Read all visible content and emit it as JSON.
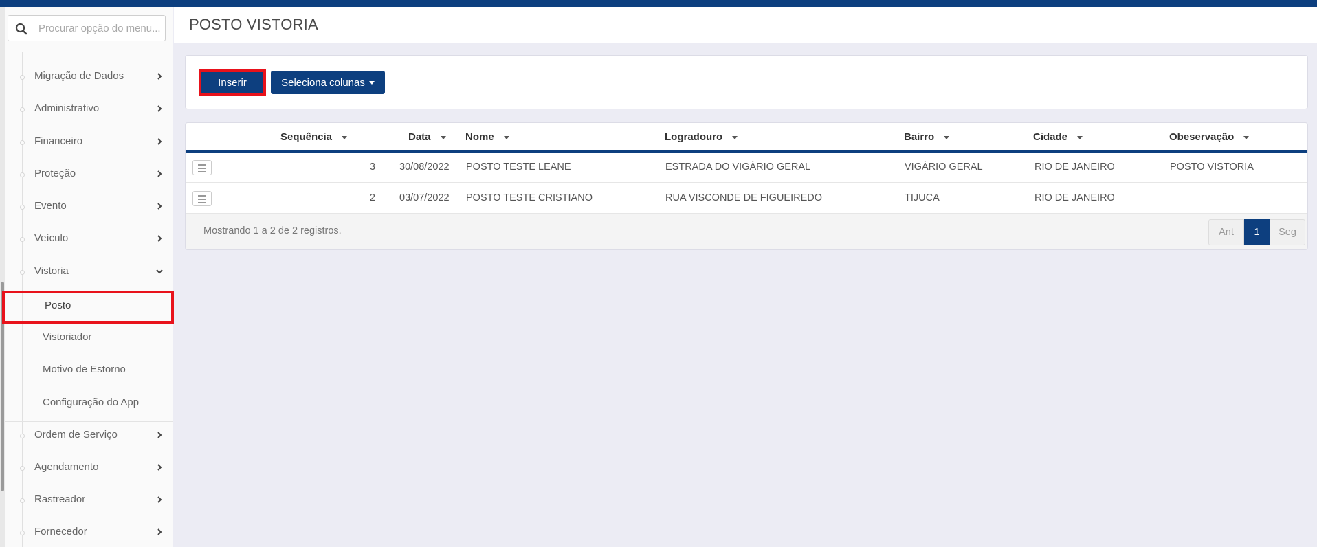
{
  "search": {
    "placeholder": "Procurar opção do menu..."
  },
  "sidebar": {
    "items": [
      {
        "label": "Migração de Dados"
      },
      {
        "label": "Administrativo"
      },
      {
        "label": "Financeiro"
      },
      {
        "label": "Proteção"
      },
      {
        "label": "Evento"
      },
      {
        "label": "Veículo"
      },
      {
        "label": "Vistoria"
      },
      {
        "label": "Ordem de Serviço"
      },
      {
        "label": "Agendamento"
      },
      {
        "label": "Rastreador"
      },
      {
        "label": "Fornecedor"
      }
    ],
    "vistoria_sub": [
      {
        "label": "Posto"
      },
      {
        "label": "Vistoriador"
      },
      {
        "label": "Motivo de Estorno"
      },
      {
        "label": "Configuração do App"
      }
    ]
  },
  "header": {
    "title": "POSTO VISTORIA"
  },
  "toolbar": {
    "insert_label": "Inserir",
    "columns_label": "Seleciona colunas"
  },
  "table": {
    "columns": [
      "Sequência",
      "Data",
      "Nome",
      "Logradouro",
      "Bairro",
      "Cidade",
      "Obeservação"
    ],
    "rows": [
      {
        "seq": "3",
        "data": "30/08/2022",
        "nome": "POSTO TESTE LEANE",
        "logradouro": "ESTRADA DO VIGÁRIO GERAL",
        "bairro": "VIGÁRIO GERAL",
        "cidade": "RIO DE JANEIRO",
        "obs": "POSTO VISTORIA"
      },
      {
        "seq": "2",
        "data": "03/07/2022",
        "nome": "POSTO TESTE CRISTIANO",
        "logradouro": "RUA VISCONDE DE FIGUEIREDO",
        "bairro": "TIJUCA",
        "cidade": "RIO DE JANEIRO",
        "obs": ""
      }
    ],
    "footer_info": "Mostrando 1 a 2 de 2 registros."
  },
  "pagination": {
    "prev": "Ant",
    "current": "1",
    "next": "Seg"
  },
  "colors": {
    "primary": "#0d3f7f",
    "highlight": "#e8121b"
  }
}
